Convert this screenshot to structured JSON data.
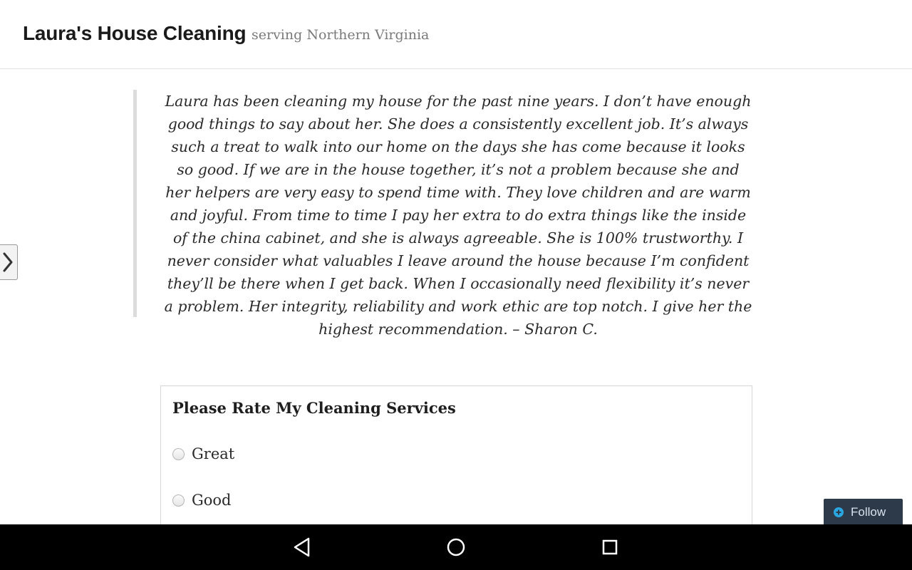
{
  "header": {
    "site_title": "Laura's House Cleaning",
    "tagline": "serving Northern Virginia"
  },
  "testimonial": {
    "text": "Laura has been cleaning my house for the past nine years.  I don’t have enough good things to say about her.  She does a consistently excellent job.  It’s always such a treat to walk into our home on the days she has come because it looks so good.  If we are in the house together, it’s not a problem because she and her helpers are very easy to spend time with.  They love children and are warm and joyful.  From time to time I pay her extra to do extra things like the inside of the china cabinet, and she is always agreeable.  She is 100% trustworthy.  I never consider what valuables I leave around the house because I’m confident they’ll be there when I get back. When I occasionally need flexibility it’s never a problem.  Her integrity, reliability and work ethic are top notch.  I give her the highest recommendation. – Sharon C."
  },
  "poll": {
    "title": "Please Rate My Cleaning Services",
    "options": [
      {
        "label": "Great"
      },
      {
        "label": "Good"
      }
    ]
  },
  "follow": {
    "label": "Follow"
  },
  "icons": {
    "sidebar_toggle": "chevron-right-icon",
    "follow": "plus-circle-icon",
    "nav_back": "back-triangle-icon",
    "nav_home": "home-circle-icon",
    "nav_recents": "recents-square-icon"
  },
  "colors": {
    "follow_bg": "#2d3a4a",
    "follow_accent": "#2aa6e0",
    "nav_bar": "#000000"
  }
}
